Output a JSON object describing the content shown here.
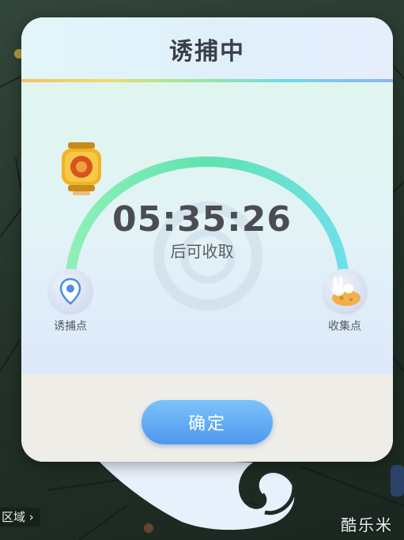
{
  "dialog": {
    "title": "诱捕中",
    "timer": "05:35:26",
    "timer_caption": "后可收取",
    "start_node_label": "诱捕点",
    "end_node_label": "收集点",
    "confirm_label": "确定",
    "progress_icon": "lantern-icon",
    "start_icon": "location-pin-icon",
    "end_icon": "rabbit-moon-icon"
  },
  "map": {
    "region_tag": "区域",
    "region_tag_icon": "chevron-right-icon"
  },
  "watermark": "酷乐米",
  "colors": {
    "arc_start": "#5fe3b0",
    "arc_end": "#6ee0e8",
    "button": "#5aa4f3",
    "title_text": "#3a3f48"
  }
}
